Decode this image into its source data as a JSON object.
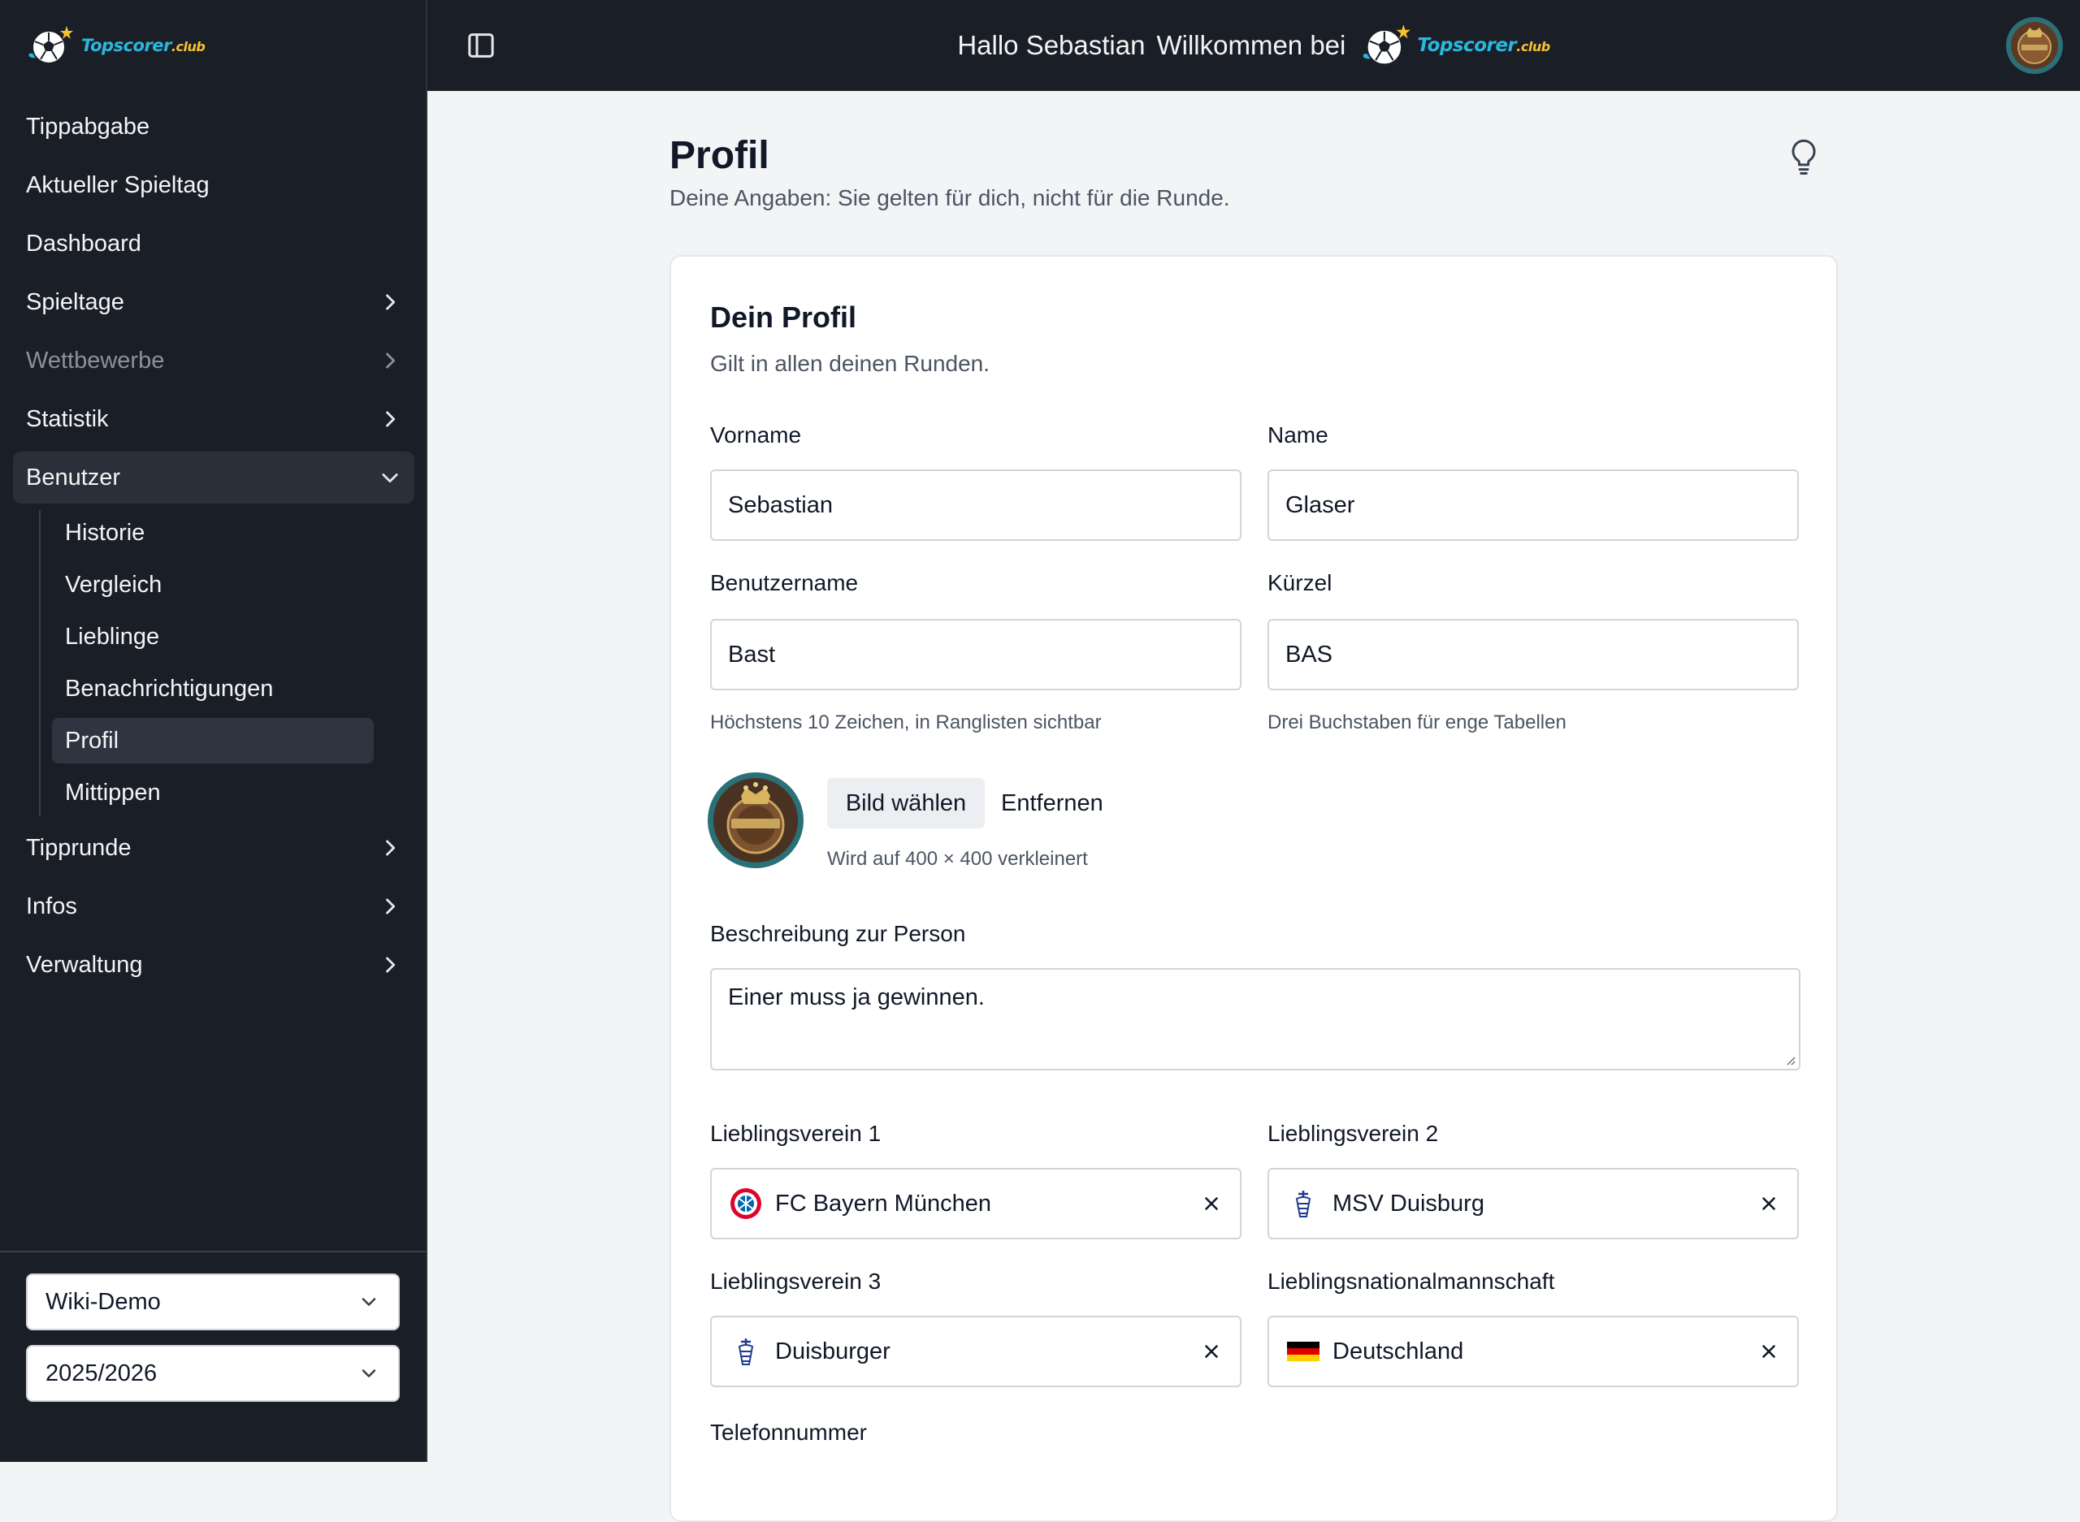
{
  "brand": {
    "name": "Topscorer",
    "suffix": ".club"
  },
  "topbar": {
    "greeting": "Hallo Sebastian",
    "welcome": "Willkommen bei"
  },
  "sidebar": {
    "items": [
      {
        "label": "Tippabgabe"
      },
      {
        "label": "Aktueller Spieltag"
      },
      {
        "label": "Dashboard"
      },
      {
        "label": "Spieltage"
      },
      {
        "label": "Wettbewerbe"
      },
      {
        "label": "Statistik"
      },
      {
        "label": "Benutzer"
      },
      {
        "label": "Tipprunde"
      },
      {
        "label": "Infos"
      },
      {
        "label": "Verwaltung"
      }
    ],
    "sub_items": [
      {
        "label": "Historie"
      },
      {
        "label": "Vergleich"
      },
      {
        "label": "Lieblinge"
      },
      {
        "label": "Benachrichtigungen"
      },
      {
        "label": "Profil"
      },
      {
        "label": "Mittippen"
      }
    ],
    "round_select": "Wiki-Demo",
    "season_select": "2025/2026"
  },
  "page": {
    "title": "Profil",
    "subtitle": "Deine Angaben: Sie gelten für dich, nicht für die Runde."
  },
  "card": {
    "title": "Dein Profil",
    "subtitle": "Gilt in allen deinen Runden.",
    "labels": {
      "firstname": "Vorname",
      "lastname": "Name",
      "username": "Benutzername",
      "short": "Kürzel",
      "description": "Beschreibung zur Person",
      "club1": "Lieblingsverein 1",
      "club2": "Lieblingsverein 2",
      "club3": "Lieblingsverein 3",
      "nation": "Lieblingsnationalmannschaft",
      "phone": "Telefonnummer"
    },
    "values": {
      "firstname": "Sebastian",
      "lastname": "Glaser",
      "username": "Bast",
      "short": "BAS",
      "description": "Einer muss ja gewinnen.",
      "club1": "FC Bayern München",
      "club2": "MSV Duisburg",
      "club3": "Duisburger",
      "nation": "Deutschland"
    },
    "hints": {
      "username": "Höchstens 10 Zeichen, in Ranglisten sichtbar",
      "short": "Drei Buchstaben für enge Tabellen",
      "picture": "Wird auf 400 × 400 verkleinert"
    },
    "buttons": {
      "choose_picture": "Bild wählen",
      "remove_picture": "Entfernen"
    }
  },
  "colors": {
    "sidebar_bg": "#1a1f27",
    "page_bg": "#f3f4f6",
    "brand_blue": "#2bb7dd",
    "brand_gold": "#f6c232"
  }
}
